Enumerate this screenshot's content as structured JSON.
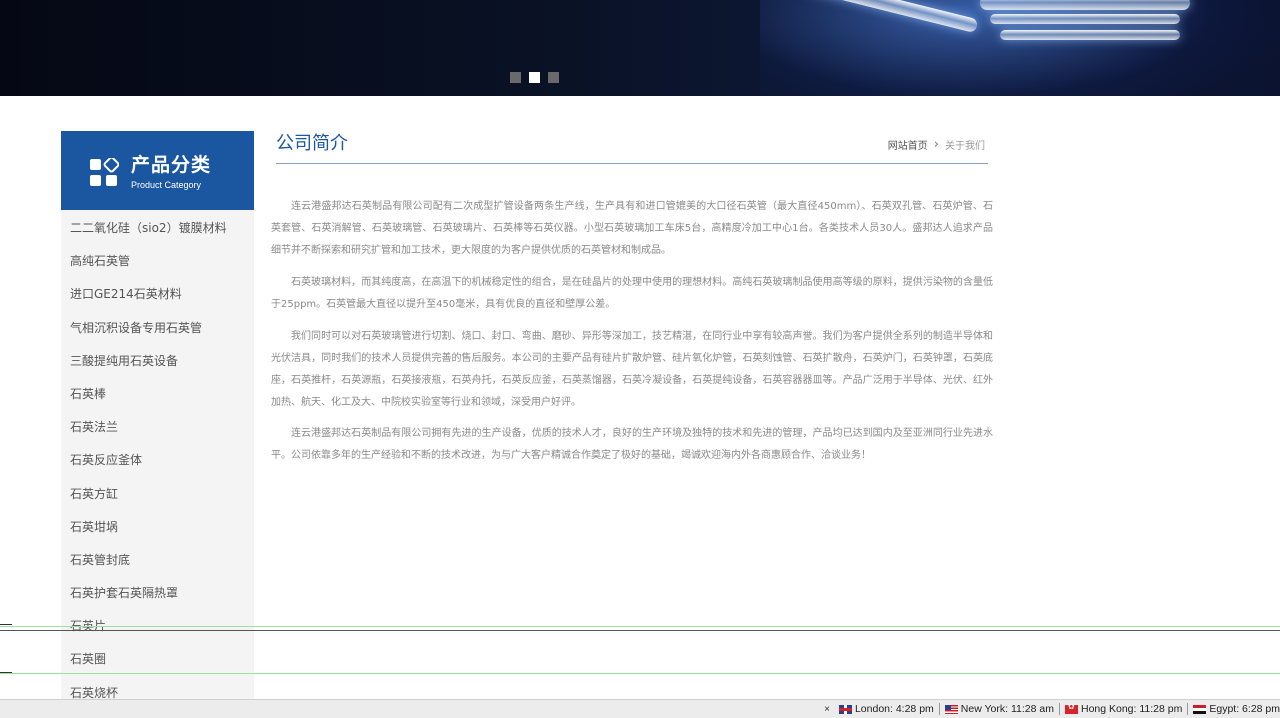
{
  "banner": {
    "slides_total": 3,
    "active_slide": 2
  },
  "sidebar": {
    "title": "产品分类",
    "subtitle": "Product Category",
    "items": [
      "二二氧化硅（sio2）镀膜材料",
      "高纯石英管",
      "进口GE214石英材料",
      "气相沉积设备专用石英管",
      "三酸提纯用石英设备",
      "石英棒",
      "石英法兰",
      "石英反应釜体",
      "石英方缸",
      "石英坩埚",
      "石英管封底",
      "石英护套石英隔热罩",
      "石英片",
      "石英圈",
      "石英烧杯"
    ]
  },
  "content": {
    "title": "公司简介",
    "breadcrumb": {
      "home": "网站首页",
      "current": "关于我们"
    },
    "paragraphs": [
      "连云港盛邦达石英制品有限公司配有二次成型扩管设备两条生产线，生产具有和进口管媲美的大口径石英管（最大直径450mm）、石英双孔管、石英炉管、石英套管、石英消解管、石英玻璃管、石英玻璃片、石英棒等石英仪器。小型石英玻璃加工车床5台，高精度冷加工中心1台。各类技术人员30人。盛邦达人追求产品细节并不断探索和研究扩管和加工技术，更大限度的为客户提供优质的石英管材和制成品。",
      "石英玻璃材料，而其纯度高，在高温下的机械稳定性的组合，是在硅晶片的处理中使用的理想材料。高纯石英玻璃制品使用高等级的原料，提供污染物的含量低于25ppm。石英管最大直径以提升至450毫米，具有优良的直径和壁厚公差。",
      "我们同时可以对石英玻璃管进行切割、烧口、封口、弯曲、磨砂、异形等深加工，技艺精湛，在同行业中享有较高声誉。我们为客户提供全系列的制造半导体和光伏洁具，同时我们的技术人员提供完善的售后服务。本公司的主要产品有硅片扩散炉管、硅片氧化炉管，石英刻蚀管、石英扩散舟，石英炉门，石英钟罩，石英底座，石英推杆，石英源瓶，石英接液瓶，石英舟托，石英反应釜，石英蒸馏器，石英冷凝设备，石英提纯设备，石英容器器皿等。产品广泛用于半导体、光伏、红外加热、航天、化工及大、中院校实验室等行业和领域，深受用户好评。",
      "连云港盛邦达石英制品有限公司拥有先进的生产设备，优质的技术人才，良好的生产环境及独特的技术和先进的管理，产品均已达到国内及至亚洲同行业先进水平。公司依靠多年的生产经验和不断的技术改进，为与广大客户精诚合作奠定了极好的基础，竭诚欢迎海内外各商惠顾合作、洽谈业务！"
    ]
  },
  "taskbar": {
    "close": "×",
    "clocks": [
      {
        "label": "London: 4:28 pm",
        "flag": "uk-flag-icon"
      },
      {
        "label": "New York: 11:28 am",
        "flag": "us-flag-icon"
      },
      {
        "label": "Hong Kong: 11:28 pm",
        "flag": "hk-flag-icon"
      },
      {
        "label": "Egypt: 6:28 pm",
        "flag": "eg-flag-icon"
      }
    ]
  },
  "colors": {
    "brand_blue": "#1b56a0",
    "sidebar_bg": "#f4f4f4",
    "body_text": "#8a8a8a"
  }
}
